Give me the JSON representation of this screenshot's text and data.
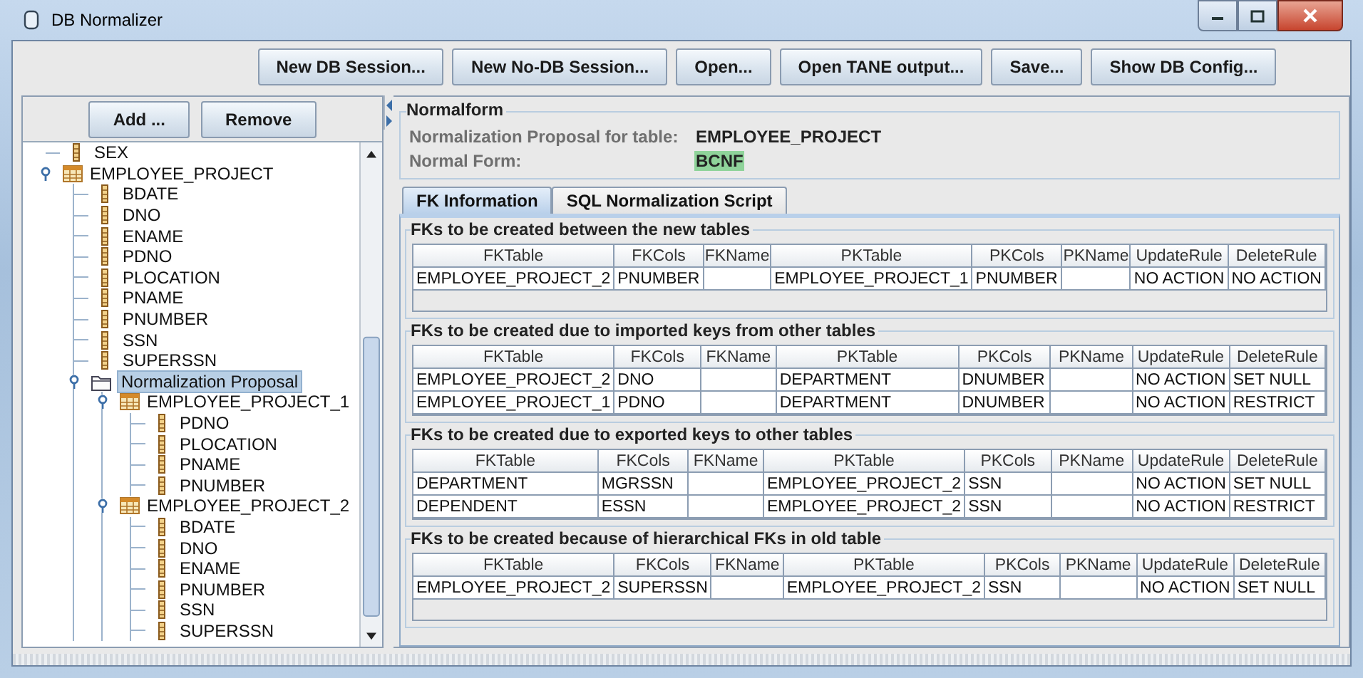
{
  "window": {
    "title": "DB Normalizer"
  },
  "toolbar": {
    "buttons": [
      "New DB Session...",
      "New No-DB Session...",
      "Open...",
      "Open TANE output...",
      "Save...",
      "Show DB Config..."
    ]
  },
  "tree_panel": {
    "buttons": [
      "Add ...",
      "Remove"
    ]
  },
  "tree": {
    "items": [
      {
        "label": "SEX",
        "kind": "column",
        "selected": false
      },
      {
        "label": "EMPLOYEE_PROJECT",
        "kind": "table",
        "expanded": true,
        "selected": false,
        "children": [
          {
            "label": "BDATE",
            "kind": "column",
            "selected": false
          },
          {
            "label": "DNO",
            "kind": "column",
            "selected": false
          },
          {
            "label": "ENAME",
            "kind": "column",
            "selected": false
          },
          {
            "label": "PDNO",
            "kind": "column",
            "selected": false
          },
          {
            "label": "PLOCATION",
            "kind": "column",
            "selected": false
          },
          {
            "label": "PNAME",
            "kind": "column",
            "selected": false
          },
          {
            "label": "PNUMBER",
            "kind": "column",
            "selected": false
          },
          {
            "label": "SSN",
            "kind": "column",
            "selected": false
          },
          {
            "label": "SUPERSSN",
            "kind": "column",
            "selected": false
          },
          {
            "label": "Normalization Proposal",
            "kind": "folder",
            "expanded": true,
            "selected": true,
            "children": [
              {
                "label": "EMPLOYEE_PROJECT_1",
                "kind": "table",
                "expanded": true,
                "selected": false,
                "children": [
                  {
                    "label": "PDNO",
                    "kind": "column",
                    "selected": false
                  },
                  {
                    "label": "PLOCATION",
                    "kind": "column",
                    "selected": false
                  },
                  {
                    "label": "PNAME",
                    "kind": "column",
                    "selected": false
                  },
                  {
                    "label": "PNUMBER",
                    "kind": "column",
                    "selected": false
                  }
                ]
              },
              {
                "label": "EMPLOYEE_PROJECT_2",
                "kind": "table",
                "expanded": true,
                "selected": false,
                "children": [
                  {
                    "label": "BDATE",
                    "kind": "column",
                    "selected": false
                  },
                  {
                    "label": "DNO",
                    "kind": "column",
                    "selected": false
                  },
                  {
                    "label": "ENAME",
                    "kind": "column",
                    "selected": false
                  },
                  {
                    "label": "PNUMBER",
                    "kind": "column",
                    "selected": false
                  },
                  {
                    "label": "SSN",
                    "kind": "column",
                    "selected": false
                  },
                  {
                    "label": "SUPERSSN",
                    "kind": "column",
                    "selected": false
                  }
                ]
              }
            ]
          }
        ]
      }
    ]
  },
  "normalform": {
    "title": "Normalform",
    "fields": [
      {
        "label": "Normalization Proposal for table:",
        "value": "EMPLOYEE_PROJECT",
        "highlighted": false
      },
      {
        "label": "Normal Form:",
        "value": "BCNF",
        "highlighted": true
      }
    ]
  },
  "tabs": [
    {
      "label": "FK Information",
      "selected": true
    },
    {
      "label": "SQL Normalization Script",
      "selected": false
    }
  ],
  "fk_sections": [
    {
      "title": "FKs to be created between the new tables",
      "columns": [
        "FKTable",
        "FKCols",
        "FKName",
        "PKTable",
        "PKCols",
        "PKName",
        "UpdateRule",
        "DeleteRule"
      ],
      "rows": [
        [
          "EMPLOYEE_PROJECT_2",
          "PNUMBER",
          "",
          "EMPLOYEE_PROJECT_1",
          "PNUMBER",
          "",
          "NO ACTION",
          "NO ACTION"
        ]
      ]
    },
    {
      "title": "FKs to be created due to imported keys from other tables",
      "columns": [
        "FKTable",
        "FKCols",
        "FKName",
        "PKTable",
        "PKCols",
        "PKName",
        "UpdateRule",
        "DeleteRule"
      ],
      "rows": [
        [
          "EMPLOYEE_PROJECT_2",
          "DNO",
          "",
          "DEPARTMENT",
          "DNUMBER",
          "",
          "NO ACTION",
          "SET NULL"
        ],
        [
          "EMPLOYEE_PROJECT_1",
          "PDNO",
          "",
          "DEPARTMENT",
          "DNUMBER",
          "",
          "NO ACTION",
          "RESTRICT"
        ]
      ]
    },
    {
      "title": "FKs to be created due to exported keys to other tables",
      "columns": [
        "FKTable",
        "FKCols",
        "FKName",
        "PKTable",
        "PKCols",
        "PKName",
        "UpdateRule",
        "DeleteRule"
      ],
      "rows": [
        [
          "DEPARTMENT",
          "MGRSSN",
          "",
          "EMPLOYEE_PROJECT_2",
          "SSN",
          "",
          "NO ACTION",
          "SET NULL"
        ],
        [
          "DEPENDENT",
          "ESSN",
          "",
          "EMPLOYEE_PROJECT_2",
          "SSN",
          "",
          "NO ACTION",
          "RESTRICT"
        ]
      ]
    },
    {
      "title": "FKs to be created because of hierarchical FKs in old table",
      "columns": [
        "FKTable",
        "FKCols",
        "FKName",
        "PKTable",
        "PKCols",
        "PKName",
        "UpdateRule",
        "DeleteRule"
      ],
      "rows": [
        [
          "EMPLOYEE_PROJECT_2",
          "SUPERSSN",
          "",
          "EMPLOYEE_PROJECT_2",
          "SSN",
          "",
          "NO ACTION",
          "SET NULL"
        ]
      ]
    }
  ]
}
